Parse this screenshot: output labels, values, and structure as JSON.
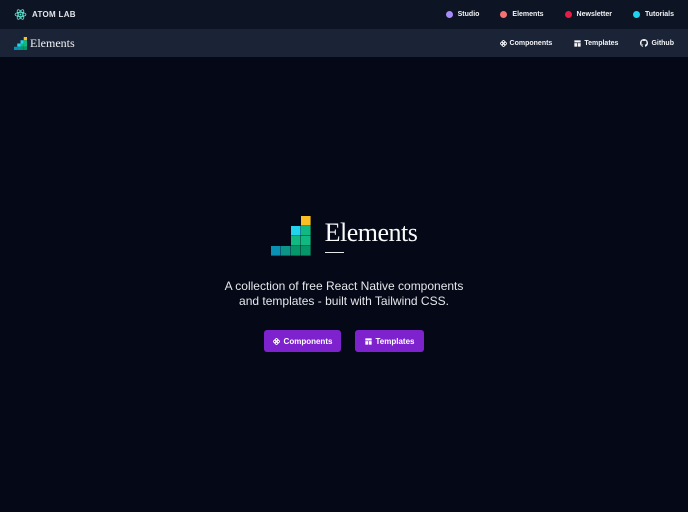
{
  "topbar": {
    "brand": "ATOM LAB",
    "links": [
      {
        "label": "Studio",
        "color": "#a78bfa"
      },
      {
        "label": "Elements",
        "color": "#f87171"
      },
      {
        "label": "Newsletter",
        "color": "#e11d48"
      },
      {
        "label": "Tutorials",
        "color": "#22d3ee"
      }
    ]
  },
  "navbar": {
    "logo_text": "Elements",
    "links": [
      {
        "label": "Components",
        "icon": "components-icon"
      },
      {
        "label": "Templates",
        "icon": "templates-icon"
      },
      {
        "label": "Github",
        "icon": "github-icon"
      }
    ]
  },
  "hero": {
    "title": "Elements",
    "tagline_line1": "A collection of free React Native components",
    "tagline_line2": "and templates - built with Tailwind CSS.",
    "buttons": {
      "components": "Components",
      "templates": "Templates"
    }
  },
  "colors": {
    "background": "#050816",
    "topbar": "#0d1424",
    "navbar": "#1b2436",
    "button": "#7e22ce",
    "logo_yellow": "#fbbf24",
    "logo_cyan": "#22d3ee",
    "logo_teal": "#0891b2",
    "logo_green": "#10b981",
    "logo_darkgreen": "#059669"
  }
}
